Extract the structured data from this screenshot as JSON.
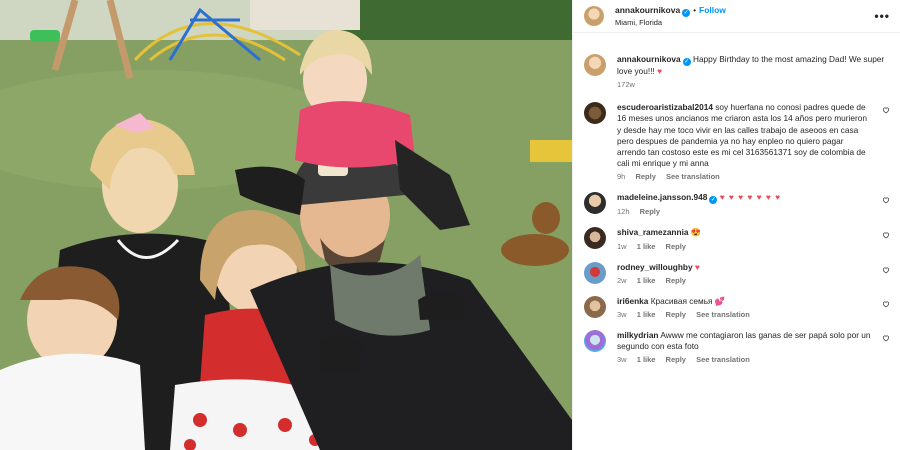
{
  "post": {
    "author": "annakournikova",
    "follow_label": "Follow",
    "separator": "•",
    "location": "Miami, Florida",
    "more_label": "•••",
    "caption": {
      "username": "annakournikova",
      "text": "Happy Birthday to the most amazing Dad! We super love you!!!",
      "emoji": "♥",
      "age": "172w"
    }
  },
  "comments": [
    {
      "username": "escuderoaristizabal2014",
      "text": "soy huerfana no conosi padres quede de 16 meses unos ancianos me criaron asta los 14 años pero murieron y desde hay me toco vivir en las calles trabajo de aseoos en casa pero despues de pandemia ya no hay enpleo no quiero pagar arrendo tan costoso este es mi cel 3163561371 soy de colombia de cali mi enrique y mi anna",
      "age": "9h",
      "reply": "Reply",
      "translate": "See translation"
    },
    {
      "username": "madeleine.jansson.948",
      "text": "♥ ♥ ♥ ♥ ♥ ♥ ♥",
      "age": "12h",
      "reply": "Reply"
    },
    {
      "username": "shiva_ramezannia",
      "text": "😍",
      "age": "1w",
      "likes": "1 like",
      "reply": "Reply"
    },
    {
      "username": "rodney_willoughby",
      "text": "♥",
      "age": "2w",
      "likes": "1 like",
      "reply": "Reply"
    },
    {
      "username": "iri6enka",
      "text": "Красивая семья 💕",
      "age": "3w",
      "likes": "1 like",
      "reply": "Reply",
      "translate": "See translation"
    },
    {
      "username": "milkydrian",
      "text": "Awww me contagiaron las ganas de ser papá solo por un segundo con esta foto",
      "age": "3w",
      "likes": "1 like",
      "reply": "Reply",
      "translate": "See translation"
    }
  ],
  "icons": {
    "verified": "verified-badge-icon",
    "like": "heart-outline-icon",
    "more": "more-options-icon"
  },
  "colors": {
    "link": "#0095f6",
    "heart": "#ed4956",
    "muted": "#737373"
  }
}
